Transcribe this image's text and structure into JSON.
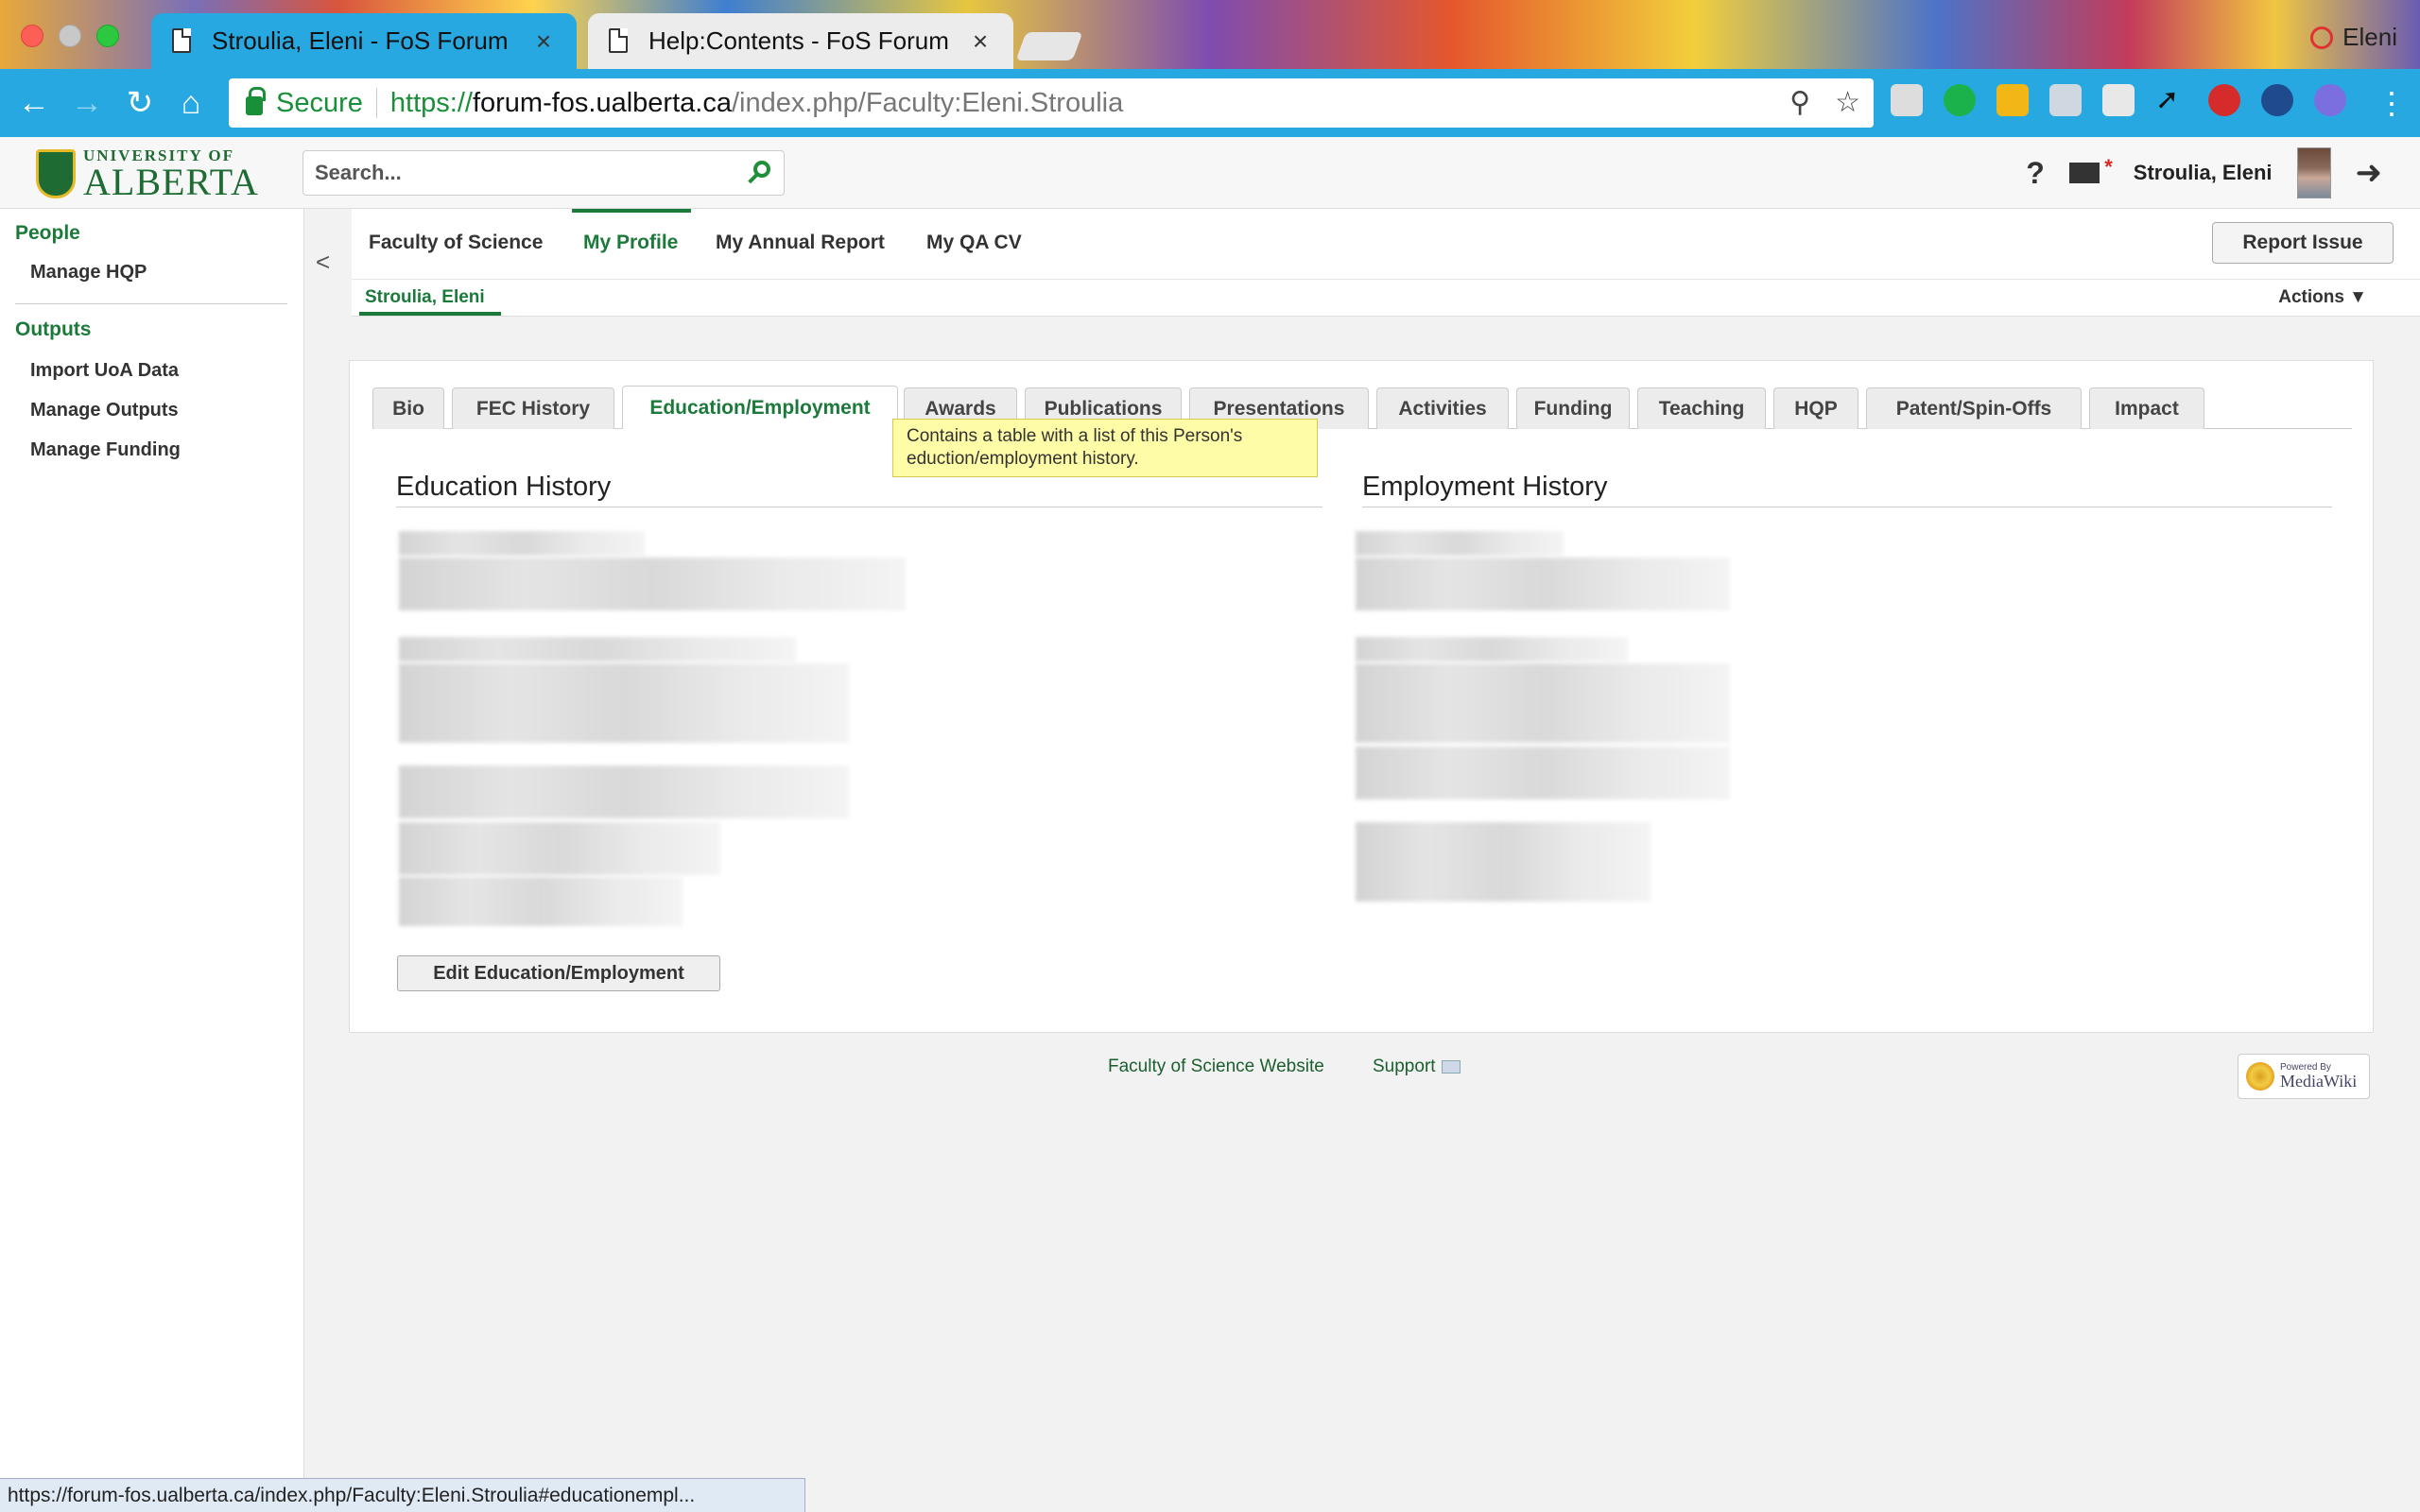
{
  "browser": {
    "tabs": [
      {
        "title": "Stroulia, Eleni - FoS Forum",
        "close": "×"
      },
      {
        "title": "Help:Contents - FoS Forum",
        "close": "×"
      }
    ],
    "profile": "Eleni",
    "omnibox": {
      "secure_label": "Secure",
      "url_scheme": "https://",
      "url_host": "forum-fos.ualberta.ca",
      "url_path": "/index.php/Faculty:Eleni.Stroulia"
    },
    "status_url": "https://forum-fos.ualberta.ca/index.php/Faculty:Eleni.Stroulia#educationempl..."
  },
  "header": {
    "logo_top": "UNIVERSITY OF",
    "logo_main": "ALBERTA",
    "search_placeholder": "Search...",
    "help": "?",
    "user_name": "Stroulia, Eleni"
  },
  "sidebar": {
    "sections": [
      {
        "heading": "People",
        "items": [
          "Manage HQP"
        ]
      },
      {
        "heading": "Outputs",
        "items": [
          "Import UoA Data",
          "Manage Outputs",
          "Manage Funding"
        ]
      }
    ]
  },
  "top_nav": {
    "collapse": "<",
    "items": [
      "Faculty of Science",
      "My Profile",
      "My Annual Report",
      "My QA CV"
    ],
    "active": "My Profile",
    "report_issue": "Report Issue",
    "sub_item": "Stroulia, Eleni",
    "actions": "Actions ▼"
  },
  "profile_tabs": {
    "items": [
      "Bio",
      "FEC History",
      "Education/Employment",
      "Awards",
      "Publications",
      "Presentations",
      "Activities",
      "Funding",
      "Teaching",
      "HQP",
      "Patent/Spin-Offs",
      "Impact"
    ],
    "active": "Education/Employment",
    "tooltip": "Contains a table with a list of this Person's eduction/employment history."
  },
  "main": {
    "education_title": "Education History",
    "employment_title": "Employment History",
    "edit_button": "Edit Education/Employment"
  },
  "footer": {
    "website_link": "Faculty of Science Website",
    "support_link": "Support",
    "badge_small": "Powered By",
    "badge_main": "MediaWiki"
  },
  "colors": {
    "chrome_blue": "#27a8e0",
    "ua_green": "#1b7a3a",
    "tooltip_bg": "#fefca6"
  }
}
